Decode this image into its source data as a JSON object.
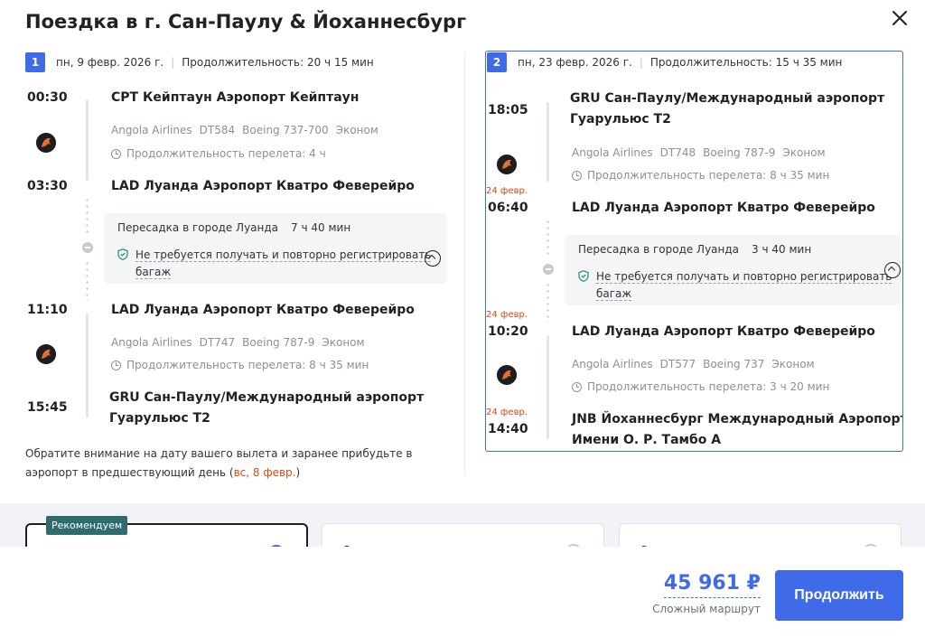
{
  "title": "Поездка в г. Сан-Паулу & Йоханнесбург",
  "colors": {
    "accent": "#3f6be8",
    "warning": "#d64b13",
    "tag": "#2f6b6f"
  },
  "legs": [
    {
      "index": "1",
      "date": "пн, 9 февр. 2026 г.",
      "duration": "Продолжительность: 20 ч 15 мин",
      "segments": [
        {
          "dep_time": "00:30",
          "dep_airport": "CPT Кейптаун Аэропорт Кейптаун",
          "airline": "Angola Airlines",
          "flight": "DT584",
          "aircraft": "Boeing 737-700",
          "cabin": "Эконом",
          "flight_duration": "Продолжительность перелета: 4 ч",
          "arr_time": "03:30",
          "arr_airport": "LAD Луанда Аэропорт Кватро Феверейро"
        },
        {
          "dep_time": "11:10",
          "dep_airport": "LAD Луанда Аэропорт Кватро Феверейро",
          "airline": "Angola Airlines",
          "flight": "DT747",
          "aircraft": "Boeing 787-9",
          "cabin": "Эконом",
          "flight_duration": "Продолжительность перелета: 8 ч 35 мин",
          "arr_time": "15:45",
          "arr_airport_line1": "GRU Сан-Паулу/Международный аэропорт",
          "arr_airport_line2": "Гуарульюс T2"
        }
      ],
      "layover": {
        "title": "Пересадка в городе Луанда",
        "duration": "7 ч 40 мин",
        "note_line1": "Не требуется получать и повторно регистрировать",
        "note_line2": "багаж"
      }
    },
    {
      "index": "2",
      "date": "пн, 23 февр. 2026 г.",
      "duration": "Продолжительность: 15 ч 35 мин",
      "segments": [
        {
          "dep_time": "18:05",
          "dep_airport_line1": "GRU Сан-Паулу/Международный аэропорт",
          "dep_airport_line2": "Гуарульюс T2",
          "airline": "Angola Airlines",
          "flight": "DT748",
          "aircraft": "Boeing 787-9",
          "cabin": "Эконом",
          "flight_duration": "Продолжительность перелета: 8 ч 35 мин",
          "arr_date": "24 февр.",
          "arr_time": "06:40",
          "arr_airport": "LAD Луанда Аэропорт Кватро Феверейро"
        },
        {
          "dep_date": "24 февр.",
          "dep_time": "10:20",
          "dep_airport": "LAD Луанда Аэропорт Кватро Феверейро",
          "airline": "Angola Airlines",
          "flight": "DT577",
          "aircraft": "Boeing 737",
          "cabin": "Эконом",
          "flight_duration": "Продолжительность перелета: 3 ч 20 мин",
          "arr_date": "24 февр.",
          "arr_time": "14:40",
          "arr_airport_line1": "JNB Йоханнесбург Международный Аэропорт",
          "arr_airport_line2": "Имени О. Р. Тамбо А"
        }
      ],
      "layover": {
        "title": "Пересадка в городе Луанда",
        "duration": "3 ч 40 мин",
        "note_line1": "Не требуется получать и повторно регистрировать",
        "note_line2": "багаж"
      }
    }
  ],
  "notice": {
    "text": "Обратите внимание на дату вашего вылета и заранее прибудьте в аэропорт в предшествующий день (",
    "highlight": "вс, 8 февр.",
    "end": ")"
  },
  "fares": {
    "recommended_tag": "Рекомендуем"
  },
  "footer": {
    "price": "45 961 ₽",
    "price_note": "Сложный маршрут",
    "continue_label": "Продолжить"
  }
}
